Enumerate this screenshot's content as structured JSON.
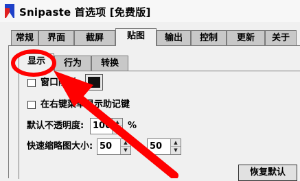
{
  "window": {
    "title": "Snipaste 首选项 [免费版]",
    "accent_color": "#ff0000"
  },
  "main_tabs": [
    {
      "label": "常规"
    },
    {
      "label": "界面"
    },
    {
      "label": "截屏"
    },
    {
      "label": "贴图"
    },
    {
      "label": "输出"
    },
    {
      "label": "控制"
    },
    {
      "label": "更新"
    },
    {
      "label": "关于"
    }
  ],
  "sub_tabs": [
    {
      "label": "显示"
    },
    {
      "label": "行为"
    },
    {
      "label": "转换"
    }
  ],
  "display": {
    "window_shadow_label": "窗口阴影",
    "window_shadow_checked": false,
    "shadow_color": "#111111",
    "show_mnemonic_label": "在右键菜单显示助记键",
    "show_mnemonic_checked": false,
    "opacity_label": "默认不透明度:",
    "opacity_value": "100",
    "opacity_unit": "%",
    "thumb_size_label": "快速缩略图大小:",
    "thumb_width": "50",
    "thumb_separator": "x",
    "thumb_height": "50",
    "reset_label": "恢复默认"
  },
  "annotation": {
    "type": "circle-and-arrow",
    "target": "显示",
    "color": "#ff0000"
  }
}
